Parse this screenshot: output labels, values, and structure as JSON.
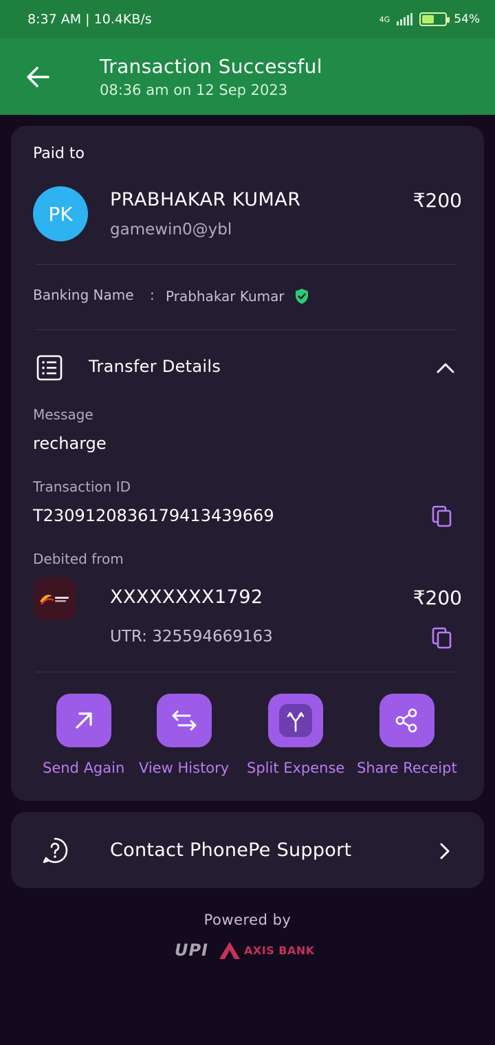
{
  "status_bar": {
    "time": "8:37 AM",
    "net_speed": "10.4KB/s",
    "network": "4G",
    "battery": "54%"
  },
  "header": {
    "title": "Transaction Successful",
    "subtitle": "08:36 am on 12 Sep 2023"
  },
  "paid_to": {
    "label": "Paid to",
    "avatar_initials": "PK",
    "name": "PRABHAKAR KUMAR",
    "vpa": "gamewin0@ybl",
    "amount": "₹200",
    "banking_name_label": "Banking Name",
    "banking_name_sep": ":",
    "banking_name": "Prabhakar Kumar"
  },
  "transfer_details": {
    "title": "Transfer Details",
    "message_label": "Message",
    "message": "recharge",
    "txn_id_label": "Transaction ID",
    "txn_id": "T2309120836179413439669",
    "debited_label": "Debited from",
    "account": "XXXXXXXX1792",
    "amount": "₹200",
    "utr": "UTR: 325594669163"
  },
  "actions": [
    {
      "label": "Send Again",
      "icon": "arrow-up-right-icon"
    },
    {
      "label": "View History",
      "icon": "swap-arrows-icon"
    },
    {
      "label": "Split Expense",
      "icon": "split-icon"
    },
    {
      "label": "Share Receipt",
      "icon": "share-icon"
    }
  ],
  "support": {
    "label": "Contact PhonePe Support"
  },
  "footer": {
    "powered_by": "Powered by",
    "upi": "UPI",
    "bank": "AXIS BANK"
  },
  "colors": {
    "header_green": "#1f8b47",
    "card_bg": "#241c30",
    "page_bg": "#130a1e",
    "accent_purple": "#9c5ce8",
    "avatar_blue": "#2fb2f0",
    "verified_green": "#2ecc71"
  }
}
